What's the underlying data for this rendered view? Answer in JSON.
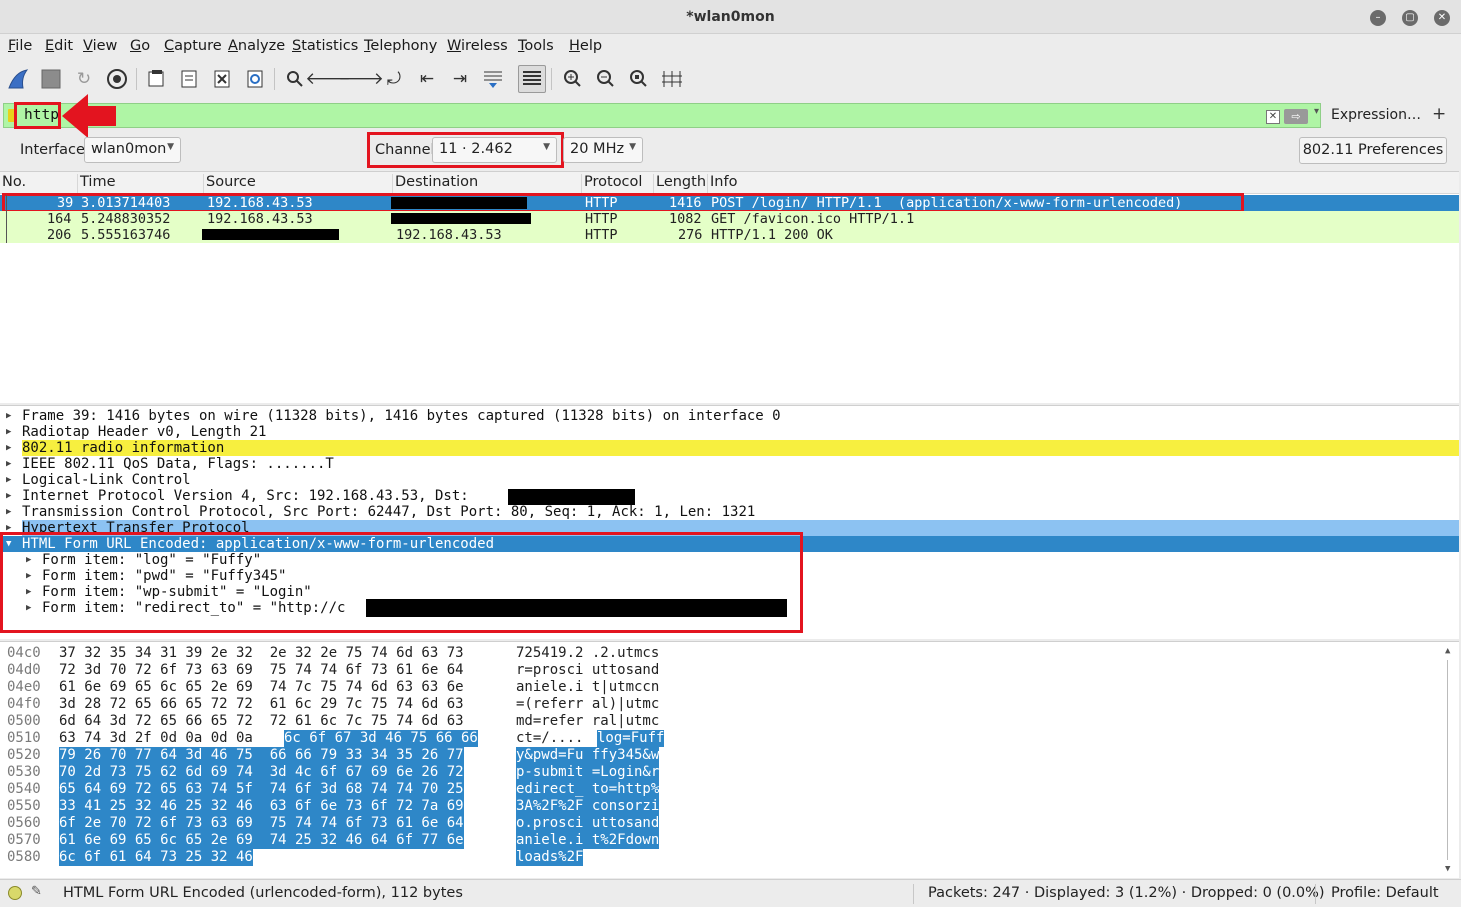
{
  "window": {
    "title": "*wlan0mon",
    "controls": [
      "minimize",
      "maximize",
      "close"
    ]
  },
  "menu": [
    "File",
    "Edit",
    "View",
    "Go",
    "Capture",
    "Analyze",
    "Statistics",
    "Telephony",
    "Wireless",
    "Tools",
    "Help"
  ],
  "toolbar": {
    "icons": [
      "shark-fin-start-icon",
      "stop-square-icon",
      "restart-capture-icon",
      "capture-options-gear-icon",
      "open-file-icon",
      "save-file-icon",
      "close-file-icon",
      "reload-file-icon",
      "find-packet-icon",
      "go-back-icon",
      "go-forward-icon",
      "go-to-packet-icon",
      "go-first-icon",
      "go-last-icon",
      "autoscroll-icon",
      "colorize-icon",
      "zoom-in-icon",
      "zoom-out-icon",
      "zoom-normal-icon",
      "resize-columns-icon"
    ]
  },
  "filter": {
    "value": "http",
    "expression_label": "Expression…",
    "plus_label": "+",
    "background": "#aff5a5"
  },
  "wireless": {
    "interface_label": "Interface",
    "interface_value": "wlan0mon",
    "channel_label": "Channel",
    "channel_value": "11 · 2.462",
    "width_value": "20 MHz",
    "preferences_label": "802.11 Preferences"
  },
  "packet_list": {
    "columns": [
      "No.",
      "Time",
      "Source",
      "Destination",
      "Protocol",
      "Length",
      "Info"
    ],
    "rows": [
      {
        "no": "39",
        "time": "3.013714403",
        "source": "192.168.43.53",
        "destination": "",
        "protocol": "HTTP",
        "length": "1416",
        "info": "POST /login/ HTTP/1.1  (application/x-www-form-urlencoded)",
        "selected": true
      },
      {
        "no": "164",
        "time": "5.248830352",
        "source": "192.168.43.53",
        "destination": "",
        "protocol": "HTTP",
        "length": "1082",
        "info": "GET /favicon.ico HTTP/1.1",
        "selected": false
      },
      {
        "no": "206",
        "time": "5.555163746",
        "source": "",
        "destination": "192.168.43.53",
        "protocol": "HTTP",
        "length": "276",
        "info": "HTTP/1.1 200 OK",
        "selected": false
      }
    ]
  },
  "details": {
    "rows": [
      {
        "text": "Frame 39: 1416 bytes on wire (11328 bits), 1416 bytes captured (11328 bits) on interface 0"
      },
      {
        "text": "Radiotap Header v0, Length 21"
      },
      {
        "text": "802.11 radio information"
      },
      {
        "text": "IEEE 802.11 QoS Data, Flags: .......T"
      },
      {
        "text": "Logical-Link Control"
      },
      {
        "text": "Internet Protocol Version 4, Src: 192.168.43.53, Dst: "
      },
      {
        "text": "Transmission Control Protocol, Src Port: 62447, Dst Port: 80, Seq: 1, Ack: 1, Len: 1321"
      },
      {
        "text": "Hypertext Transfer Protocol"
      },
      {
        "text": "HTML Form URL Encoded: application/x-www-form-urlencoded"
      }
    ],
    "form_items": [
      {
        "text": "Form item: \"log\" = \"Fuffy\""
      },
      {
        "text": "Form item: \"pwd\" = \"Fuffy345\""
      },
      {
        "text": "Form item: \"wp-submit\" = \"Login\""
      },
      {
        "text": "Form item: \"redirect_to\" = \"http://c"
      }
    ]
  },
  "bytes": {
    "rows": [
      {
        "offset": "04c0",
        "hex_plain": "37 32 35 34 31 39 2e 32  2e 32 2e 75 74 6d 63 73",
        "hex_hl": "",
        "ascii_plain": "725419.2 .2.utmcs",
        "ascii_hl": ""
      },
      {
        "offset": "04d0",
        "hex_plain": "72 3d 70 72 6f 73 63 69  75 74 74 6f 73 61 6e 64",
        "hex_hl": "",
        "ascii_plain": "r=prosci uttosand",
        "ascii_hl": ""
      },
      {
        "offset": "04e0",
        "hex_plain": "61 6e 69 65 6c 65 2e 69  74 7c 75 74 6d 63 63 6e",
        "hex_hl": "",
        "ascii_plain": "aniele.i t|utmccn",
        "ascii_hl": ""
      },
      {
        "offset": "04f0",
        "hex_plain": "3d 28 72 65 66 65 72 72  61 6c 29 7c 75 74 6d 63",
        "hex_hl": "",
        "ascii_plain": "=(referr al)|utmc",
        "ascii_hl": ""
      },
      {
        "offset": "0500",
        "hex_plain": "6d 64 3d 72 65 66 65 72  72 61 6c 7c 75 74 6d 63",
        "hex_hl": "",
        "ascii_plain": "md=refer ral|utmc",
        "ascii_hl": ""
      },
      {
        "offset": "0510",
        "hex_plain": "63 74 3d 2f 0d 0a 0d 0a  ",
        "hex_hl": "6c 6f 67 3d 46 75 66 66",
        "ascii_plain": "ct=/.... ",
        "ascii_hl": "log=Fuff"
      },
      {
        "offset": "0520",
        "hex_plain": "",
        "hex_hl": "79 26 70 77 64 3d 46 75  66 66 79 33 34 35 26 77",
        "ascii_plain": "",
        "ascii_hl": "y&pwd=Fu ffy345&w"
      },
      {
        "offset": "0530",
        "hex_plain": "",
        "hex_hl": "70 2d 73 75 62 6d 69 74  3d 4c 6f 67 69 6e 26 72",
        "ascii_plain": "",
        "ascii_hl": "p-submit =Login&r"
      },
      {
        "offset": "0540",
        "hex_plain": "",
        "hex_hl": "65 64 69 72 65 63 74 5f  74 6f 3d 68 74 74 70 25",
        "ascii_plain": "",
        "ascii_hl": "edirect_ to=http%"
      },
      {
        "offset": "0550",
        "hex_plain": "",
        "hex_hl": "33 41 25 32 46 25 32 46  63 6f 6e 73 6f 72 7a 69",
        "ascii_plain": "",
        "ascii_hl": "3A%2F%2F consorzi"
      },
      {
        "offset": "0560",
        "hex_plain": "",
        "hex_hl": "6f 2e 70 72 6f 73 63 69  75 74 74 6f 73 61 6e 64",
        "ascii_plain": "",
        "ascii_hl": "o.prosci uttosand"
      },
      {
        "offset": "0570",
        "hex_plain": "",
        "hex_hl": "61 6e 69 65 6c 65 2e 69  74 25 32 46 64 6f 77 6e",
        "ascii_plain": "",
        "ascii_hl": "aniele.i t%2Fdown"
      },
      {
        "offset": "0580",
        "hex_plain": "",
        "hex_hl": "6c 6f 61 64 73 25 32 46",
        "ascii_plain": "",
        "ascii_hl": "loads%2F"
      }
    ]
  },
  "status": {
    "field_info": "HTML Form URL Encoded (urlencoded-form), 112 bytes",
    "packets": "Packets: 247 · Displayed: 3 (1.2%) · Dropped: 0 (0.0%)",
    "profile": "Profile: Default"
  },
  "colors": {
    "selection": "#2e87c8",
    "http_row": "#e4ffc7",
    "annotation_red": "#e3141f",
    "radio_info": "#f7ef3f",
    "http_header": "#8cc2f2"
  }
}
